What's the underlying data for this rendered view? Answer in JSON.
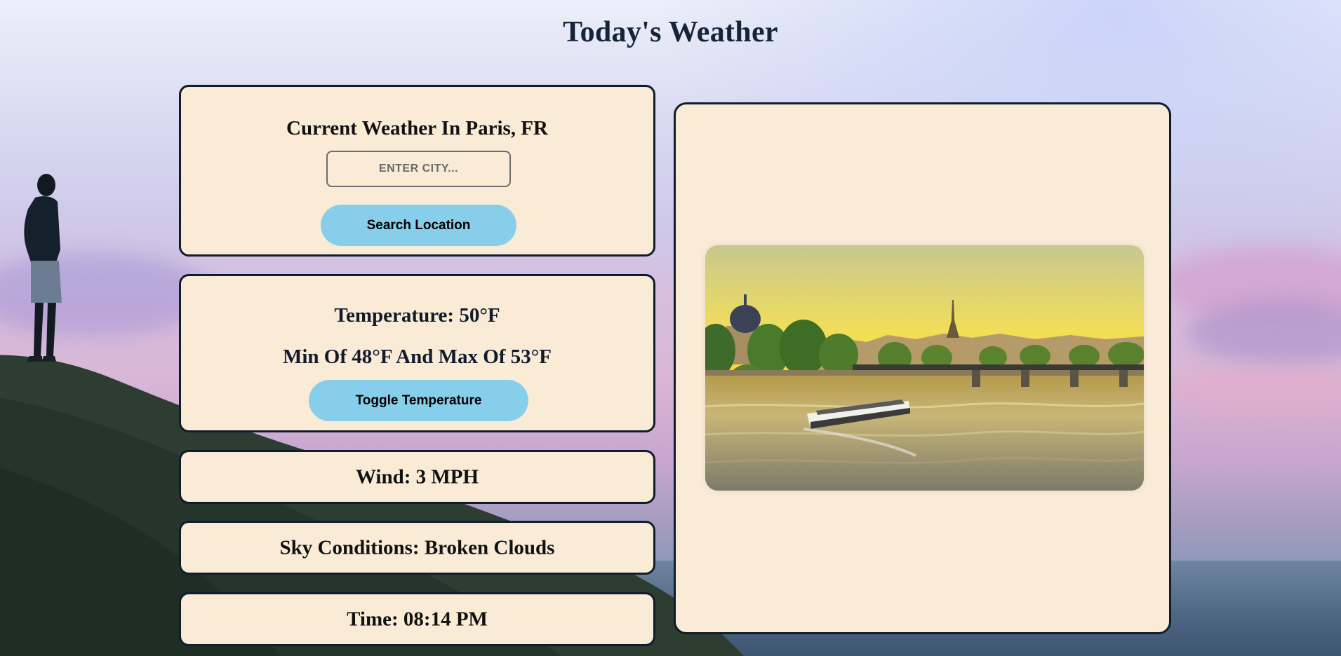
{
  "page": {
    "title": "Today's Weather"
  },
  "search_card": {
    "heading": "Current Weather In Paris, FR",
    "city_input": {
      "value": "",
      "placeholder": "ENTER CITY..."
    },
    "search_button_label": "Search Location"
  },
  "temperature_card": {
    "temperature_text": "Temperature: 50°F",
    "min_max_text": "Min Of 48°F And Max Of 53°F",
    "toggle_button_label": "Toggle Temperature"
  },
  "wind_card": {
    "text": "Wind: 3 MPH"
  },
  "sky_card": {
    "text": "Sky Conditions: Broken Clouds"
  },
  "time_card": {
    "text": "Time: 08:14 PM"
  },
  "city_photo": {
    "depicts": "Paris skyline with Seine river, bridge, tour boat and Eiffel Tower at sunset"
  },
  "colors": {
    "card_background": "#faebd7",
    "card_border": "#0f1d2c",
    "button_background": "#87ceeb",
    "title_color": "#16243a"
  }
}
